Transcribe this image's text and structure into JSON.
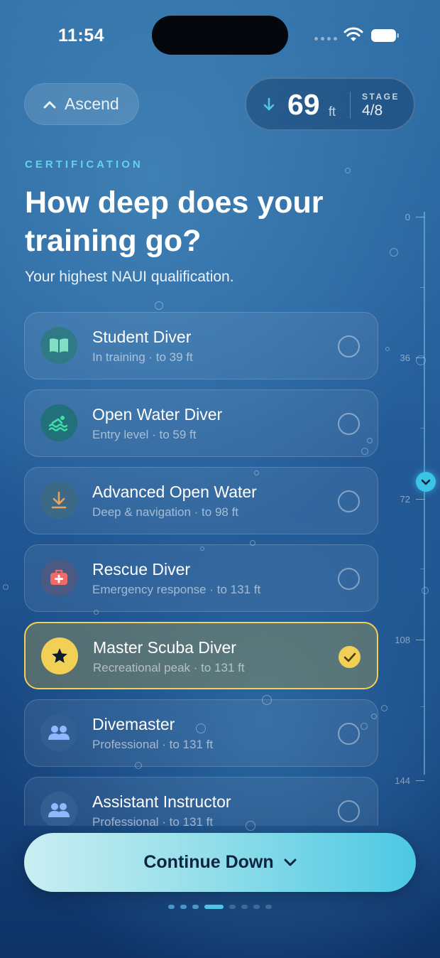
{
  "status_bar": {
    "time": "11:54"
  },
  "header": {
    "ascend_label": "Ascend",
    "depth_value": "69",
    "depth_unit": "ft",
    "stage_label": "STAGE",
    "stage_value": "4/8"
  },
  "eyebrow": "CERTIFICATION",
  "title": "How deep does your training go?",
  "subtitle": "Your highest NAUI qualification.",
  "options": [
    {
      "name": "Student Diver",
      "meta": "In training · to 39 ft",
      "icon": "book-icon",
      "icon_bg": "#2f7a86",
      "selected": false
    },
    {
      "name": "Open Water Diver",
      "meta": "Entry level · to 59 ft",
      "icon": "swimmer-icon",
      "icon_bg": "#22707a",
      "selected": false
    },
    {
      "name": "Advanced Open Water",
      "meta": "Deep & navigation · to 98 ft",
      "icon": "download-arrow-icon",
      "icon_bg": "#3c6a86",
      "selected": false
    },
    {
      "name": "Rescue Diver",
      "meta": "Emergency response · to 131 ft",
      "icon": "first-aid-kit-icon",
      "icon_bg": "#4a5a82",
      "selected": false
    },
    {
      "name": "Master Scuba Diver",
      "meta": "Recreational peak · to 131 ft",
      "icon": "star-icon",
      "icon_bg": "#f2cf55",
      "selected": true
    },
    {
      "name": "Divemaster",
      "meta": "Professional · to 131 ft",
      "icon": "people-icon",
      "icon_bg": "#325f92",
      "selected": false
    },
    {
      "name": "Assistant Instructor",
      "meta": "Professional · to 131 ft",
      "icon": "people-icon",
      "icon_bg": "#325f92",
      "selected": false
    }
  ],
  "gauge": {
    "labels": [
      "0",
      "36",
      "72",
      "108",
      "144"
    ],
    "current_depth": 69
  },
  "cta_label": "Continue Down",
  "pagination": {
    "total": 8,
    "current": 4
  },
  "colors": {
    "accent": "#4fc6e6",
    "selected": "#f2cf55"
  }
}
